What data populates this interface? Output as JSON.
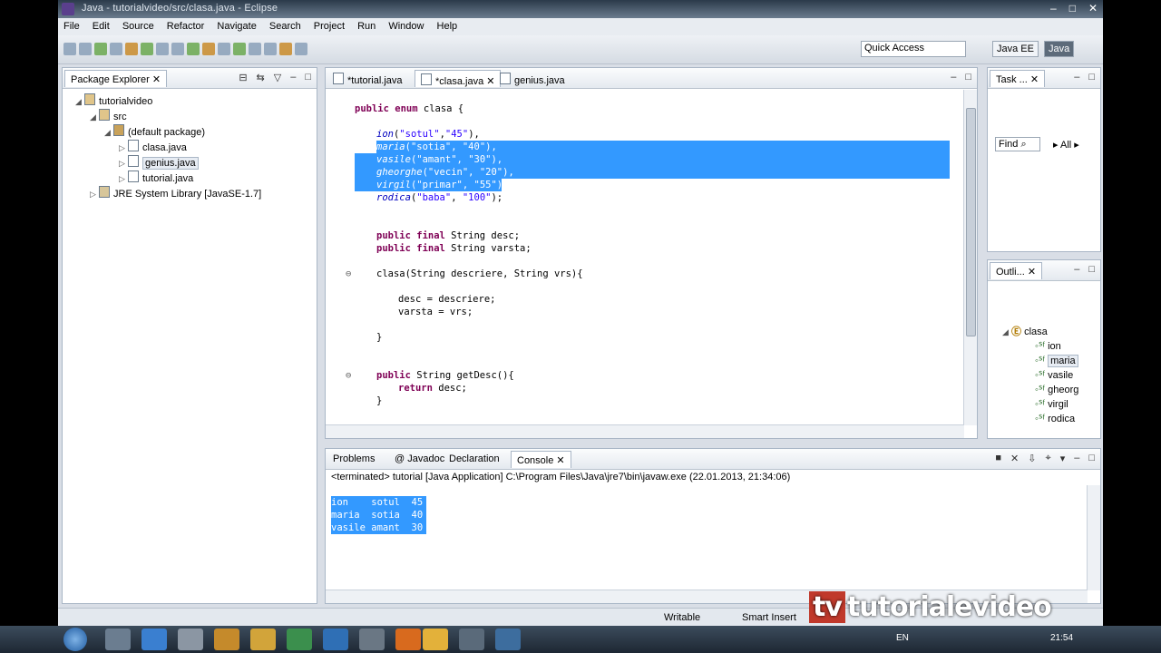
{
  "window": {
    "title": "Java - tutorialvideo/src/clasa.java - Eclipse",
    "buttons": [
      "–",
      "□",
      "✕"
    ]
  },
  "menu": [
    "File",
    "Edit",
    "Source",
    "Refactor",
    "Navigate",
    "Search",
    "Project",
    "Run",
    "Window",
    "Help"
  ],
  "quick_access": {
    "placeholder": "Quick Access"
  },
  "perspective": {
    "java_ee": "Java EE",
    "java": "Java"
  },
  "package_explorer": {
    "tab": "Package Explorer",
    "tree": {
      "project": "tutorialvideo",
      "src": "src",
      "package": "(default package)",
      "files": [
        "clasa.java",
        "genius.java",
        "tutorial.java"
      ],
      "jre": "JRE System Library [JavaSE-1.7]"
    }
  },
  "editor": {
    "tabs": [
      "*tutorial.java",
      "*clasa.java",
      "genius.java"
    ],
    "code": {
      "decl": [
        "public enum",
        " clasa {"
      ],
      "enums": [
        {
          "name": "ion",
          "a": "\"sotul\"",
          "b": "\"45\""
        },
        {
          "name": "maria",
          "a": "\"sotia\"",
          "b": "\"40\""
        },
        {
          "name": "vasile",
          "a": "\"amant\"",
          "b": "\"30\""
        },
        {
          "name": "gheorghe",
          "a": "\"vecin\"",
          "b": "\"20\""
        },
        {
          "name": "virgil",
          "a": "\"primar\"",
          "b": "\"55\""
        },
        {
          "name": "rodica",
          "a": "\"baba\"",
          "b": "\"100\""
        }
      ],
      "field1": [
        "public final",
        " String desc;"
      ],
      "field2": [
        "public final",
        " String varsta;"
      ],
      "ctor": "clasa(String descriere, String vrs){",
      "assign1": "desc = descriere;",
      "assign2": "varsta = vrs;",
      "close": "}",
      "method": [
        "public",
        " String getDesc(){"
      ],
      "ret": [
        "return",
        " desc;"
      ],
      "close2": "}"
    }
  },
  "task_list": {
    "tab": "Task ...",
    "find": "Find",
    "all": "All"
  },
  "outline": {
    "tab": "Outli...",
    "root": "clasa",
    "items": [
      "ion",
      "maria",
      "vasile",
      "gheorg",
      "virgil",
      "rodica"
    ]
  },
  "bottom": {
    "tabs": [
      "Problems",
      "Javadoc",
      "Declaration",
      "Console"
    ],
    "status": "<terminated> tutorial [Java Application] C:\\Program Files\\Java\\jre7\\bin\\javaw.exe (22.01.2013, 21:34:06)",
    "output": [
      "ion    sotul  45",
      "maria  sotia  40",
      "vasile amant  30"
    ]
  },
  "statusbar": {
    "writable": "Writable",
    "insert": "Smart Insert"
  },
  "watermark": "tutorialevideo",
  "taskbar": {
    "lang": "EN",
    "time": "21:54"
  }
}
